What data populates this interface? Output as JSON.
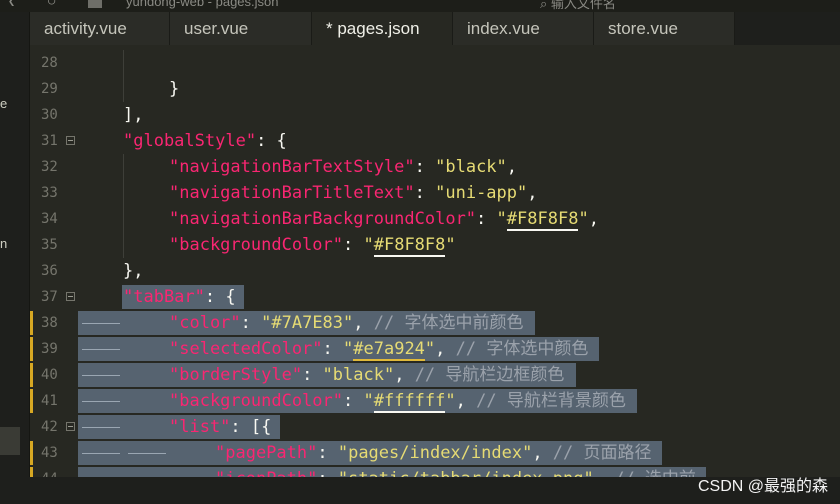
{
  "title_bar": {
    "title": "yundong-web - pages.json",
    "search_placeholder": "输入文件名"
  },
  "sidebar": {
    "fragment_1": "e",
    "fragment_2": "n"
  },
  "tabs": [
    {
      "label": "activity.vue",
      "active": false
    },
    {
      "label": "user.vue",
      "active": false
    },
    {
      "label": "* pages.json",
      "active": true
    },
    {
      "label": "index.vue",
      "active": false
    },
    {
      "label": "store.vue",
      "active": false
    }
  ],
  "editor": {
    "lines": [
      {
        "number": "28",
        "fold": false,
        "modified": false,
        "selected": false,
        "tokens": []
      },
      {
        "number": "29",
        "fold": false,
        "modified": false,
        "selected": false,
        "tokens": [
          {
            "t": "}",
            "c": "p"
          }
        ]
      },
      {
        "number": "30",
        "fold": false,
        "modified": false,
        "selected": false,
        "tokens": [
          {
            "t": "],",
            "c": "p"
          }
        ]
      },
      {
        "number": "31",
        "fold": true,
        "modified": false,
        "selected": false,
        "tokens": [
          {
            "t": "\"globalStyle\"",
            "c": "k"
          },
          {
            "t": ": {",
            "c": "p"
          }
        ]
      },
      {
        "number": "32",
        "fold": false,
        "modified": false,
        "selected": false,
        "tokens": [
          {
            "t": "\"navigationBarTextStyle\"",
            "c": "k"
          },
          {
            "t": ": ",
            "c": "p"
          },
          {
            "t": "\"black\"",
            "c": "s"
          },
          {
            "t": ",",
            "c": "p"
          }
        ]
      },
      {
        "number": "33",
        "fold": false,
        "modified": false,
        "selected": false,
        "tokens": [
          {
            "t": "\"navigationBarTitleText\"",
            "c": "k"
          },
          {
            "t": ": ",
            "c": "p"
          },
          {
            "t": "\"uni-app\"",
            "c": "s"
          },
          {
            "t": ",",
            "c": "p"
          }
        ]
      },
      {
        "number": "34",
        "fold": false,
        "modified": false,
        "selected": false,
        "tokens": [
          {
            "t": "\"navigationBarBackgroundColor\"",
            "c": "k"
          },
          {
            "t": ": ",
            "c": "p"
          },
          {
            "t": "\"",
            "c": "s"
          },
          {
            "t": "#F8F8F8",
            "c": "s",
            "u": "w"
          },
          {
            "t": "\"",
            "c": "s"
          },
          {
            "t": ",",
            "c": "p"
          }
        ]
      },
      {
        "number": "35",
        "fold": false,
        "modified": false,
        "selected": false,
        "tokens": [
          {
            "t": "\"backgroundColor\"",
            "c": "k"
          },
          {
            "t": ": ",
            "c": "p"
          },
          {
            "t": "\"",
            "c": "s"
          },
          {
            "t": "#F8F8F8",
            "c": "s",
            "u": "w"
          },
          {
            "t": "\"",
            "c": "s"
          }
        ]
      },
      {
        "number": "36",
        "fold": false,
        "modified": false,
        "selected": false,
        "tokens": [
          {
            "t": "},",
            "c": "p"
          }
        ]
      },
      {
        "number": "37",
        "fold": true,
        "modified": false,
        "selected": true,
        "tokens": [
          {
            "t": "\"tabBar\"",
            "c": "k"
          },
          {
            "t": ": {",
            "c": "p"
          }
        ]
      },
      {
        "number": "38",
        "fold": false,
        "modified": true,
        "selected": true,
        "tokens": [
          {
            "t": "\"color\"",
            "c": "k"
          },
          {
            "t": ": ",
            "c": "p"
          },
          {
            "t": "\"#7A7E83\"",
            "c": "s"
          },
          {
            "t": ", ",
            "c": "p"
          },
          {
            "t": "// 字体选中前颜色",
            "c": "c"
          }
        ]
      },
      {
        "number": "39",
        "fold": false,
        "modified": true,
        "selected": true,
        "tokens": [
          {
            "t": "\"selectedColor\"",
            "c": "k"
          },
          {
            "t": ": ",
            "c": "p"
          },
          {
            "t": "\"",
            "c": "s"
          },
          {
            "t": "#e7a924",
            "c": "s",
            "u": "y"
          },
          {
            "t": "\"",
            "c": "s"
          },
          {
            "t": ", ",
            "c": "p"
          },
          {
            "t": "// 字体选中颜色",
            "c": "c"
          }
        ]
      },
      {
        "number": "40",
        "fold": false,
        "modified": true,
        "selected": true,
        "tokens": [
          {
            "t": "\"borderStyle\"",
            "c": "k"
          },
          {
            "t": ": ",
            "c": "p"
          },
          {
            "t": "\"black\"",
            "c": "s"
          },
          {
            "t": ", ",
            "c": "p"
          },
          {
            "t": "// 导航栏边框颜色",
            "c": "c"
          }
        ]
      },
      {
        "number": "41",
        "fold": false,
        "modified": true,
        "selected": true,
        "tokens": [
          {
            "t": "\"backgroundColor\"",
            "c": "k"
          },
          {
            "t": ": ",
            "c": "p"
          },
          {
            "t": "\"",
            "c": "s"
          },
          {
            "t": "#ffffff",
            "c": "s",
            "u": "w"
          },
          {
            "t": "\"",
            "c": "s"
          },
          {
            "t": ", ",
            "c": "p"
          },
          {
            "t": "// 导航栏背景颜色",
            "c": "c"
          }
        ]
      },
      {
        "number": "42",
        "fold": true,
        "modified": false,
        "selected": true,
        "tokens": [
          {
            "t": "\"list\"",
            "c": "k"
          },
          {
            "t": ": [{",
            "c": "p"
          }
        ]
      },
      {
        "number": "43",
        "fold": false,
        "modified": true,
        "selected": true,
        "tokens": [
          {
            "t": "\"pagePath\"",
            "c": "k"
          },
          {
            "t": ": ",
            "c": "p"
          },
          {
            "t": "\"pages/index/index\"",
            "c": "s"
          },
          {
            "t": ", ",
            "c": "p"
          },
          {
            "t": "// 页面路径",
            "c": "c"
          }
        ]
      },
      {
        "number": "44",
        "fold": false,
        "modified": true,
        "selected": true,
        "tokens": [
          {
            "t": "\"iconPath\"",
            "c": "k"
          },
          {
            "t": ": ",
            "c": "p"
          },
          {
            "t": "\"static/tabbar/index.png\"",
            "c": "s"
          },
          {
            "t": ", ",
            "c": "p"
          },
          {
            "t": "// 选中前",
            "c": "c"
          }
        ]
      }
    ]
  },
  "watermark": "CSDN @最强的森",
  "colors": {
    "background": "#272822",
    "key": "#f92672",
    "string": "#e6db74",
    "comment": "#9ba2ab",
    "selection": "#566370",
    "modified_marker": "#d7a823"
  }
}
